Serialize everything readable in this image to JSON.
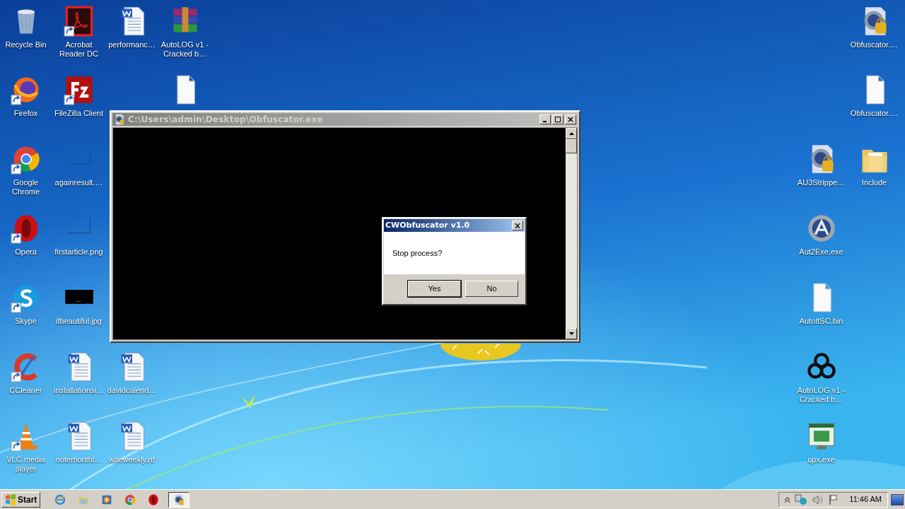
{
  "desktop": {
    "icons": [
      {
        "label": "Recycle Bin",
        "kind": "recycle",
        "shortcut": false
      },
      {
        "label": "Acrobat Reader DC",
        "kind": "pdf",
        "shortcut": true
      },
      {
        "label": "performanc…",
        "kind": "word",
        "shortcut": false
      },
      {
        "label": "AutoLOG v1 - Cracked b…",
        "kind": "rar",
        "shortcut": false
      },
      {
        "label": "Firefox",
        "kind": "firefox",
        "shortcut": true
      },
      {
        "label": "FileZilla Client",
        "kind": "filezilla",
        "shortcut": true
      },
      {
        "kind": "file",
        "shortcut": false
      },
      {
        "label": "Google Chrome",
        "kind": "chrome",
        "shortcut": true
      },
      {
        "label": "againresult.…",
        "kind": "thumb",
        "shortcut": false
      },
      {
        "label": "Opera",
        "kind": "opera",
        "shortcut": true
      },
      {
        "label": "firstarticle.png",
        "kind": "thumb",
        "shortcut": false
      },
      {
        "label": "Skype",
        "kind": "skype",
        "shortcut": true
      },
      {
        "label": "ifbeautiful.jpg",
        "kind": "dark-image",
        "shortcut": false
      },
      {
        "label": "CCleaner",
        "kind": "ccleaner",
        "shortcut": true
      },
      {
        "label": "installationsi…",
        "kind": "word",
        "shortcut": false
      },
      {
        "label": "davidcalend…",
        "kind": "word",
        "shortcut": false
      },
      {
        "label": "VLC media player",
        "kind": "vlc",
        "shortcut": true
      },
      {
        "label": "notemonthl…",
        "kind": "word",
        "shortcut": false
      },
      {
        "label": "wifeweekly.rtf",
        "kind": "word",
        "shortcut": false
      },
      {
        "label": "Obfuscator.…",
        "kind": "autoit-lock",
        "shortcut": false
      },
      {
        "label": "Obfuscator.…",
        "kind": "file",
        "shortcut": false
      },
      {
        "label": "AU3Strippe…",
        "kind": "autoit-lock",
        "shortcut": false
      },
      {
        "label": "Include",
        "kind": "folder",
        "shortcut": false
      },
      {
        "label": "Aut2Exe.exe",
        "kind": "autoit",
        "shortcut": false
      },
      {
        "label": "AutoItSC.bin",
        "kind": "file",
        "shortcut": false
      },
      {
        "label": "AutoLOG v1 - Cracked b…",
        "kind": "biohazard",
        "shortcut": false
      },
      {
        "label": "upx.exe",
        "kind": "exe",
        "shortcut": false
      }
    ]
  },
  "console_window": {
    "title": "C:\\Users\\admin\\Desktop\\Obfuscator.exe",
    "active": false
  },
  "dialog": {
    "title": "CWObfuscator v1.0",
    "message": "Stop process?",
    "buttons": [
      {
        "label": "Yes",
        "selected": true
      },
      {
        "label": "No",
        "selected": false
      }
    ]
  },
  "taskbar": {
    "start": "Start",
    "apps": [
      {
        "kind": "ie",
        "selected": false
      },
      {
        "kind": "explorer",
        "selected": false
      },
      {
        "kind": "media",
        "selected": false
      },
      {
        "kind": "chrome",
        "selected": false
      },
      {
        "kind": "opera",
        "selected": false
      },
      {
        "kind": "autoit-lock",
        "selected": true
      }
    ],
    "time": "11:46 AM"
  }
}
